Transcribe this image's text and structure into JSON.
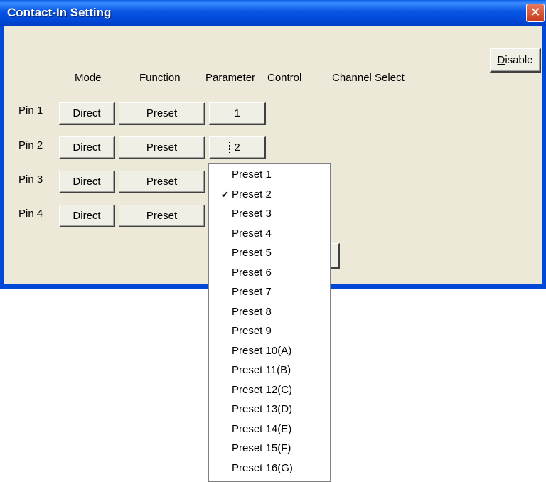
{
  "window": {
    "title": "Contact-In Setting",
    "close_glyph": "✕",
    "disable_prefix": "D",
    "disable_rest": "isable"
  },
  "headers": {
    "mode": "Mode",
    "function": "Function",
    "parameter": "Parameter",
    "control": "Control",
    "channel_select": "Channel Select"
  },
  "pins": [
    {
      "label": "Pin 1",
      "mode": "Direct",
      "function": "Preset",
      "parameter": "1"
    },
    {
      "label": "Pin 2",
      "mode": "Direct",
      "function": "Preset",
      "parameter": "2"
    },
    {
      "label": "Pin 3",
      "mode": "Direct",
      "function": "Preset"
    },
    {
      "label": "Pin 4",
      "mode": "Direct",
      "function": "Preset"
    }
  ],
  "dropdown": {
    "selected": "Preset 2",
    "check_glyph": "✔",
    "items": [
      "Preset 1",
      "Preset 2",
      "Preset 3",
      "Preset 4",
      "Preset 5",
      "Preset 6",
      "Preset 7",
      "Preset 8",
      "Preset 9",
      "Preset 10(A)",
      "Preset 11(B)",
      "Preset 12(C)",
      "Preset 13(D)",
      "Preset 14(E)",
      "Preset 15(F)",
      "Preset 16(G)"
    ]
  },
  "colors": {
    "titlebar": "#0054e3",
    "dialog_bg": "#ece9d8",
    "close_button": "#d54a28"
  }
}
